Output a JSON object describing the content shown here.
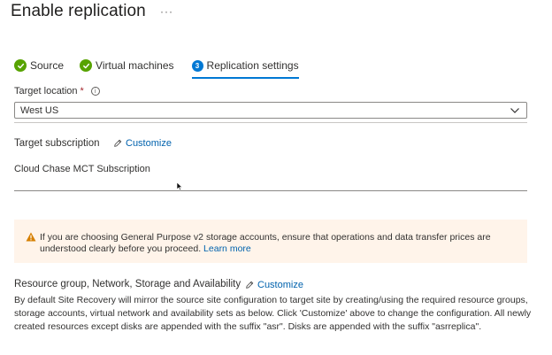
{
  "header": {
    "title": "Enable replication",
    "more_label": "···"
  },
  "steps": [
    {
      "label": "Source",
      "status": "complete"
    },
    {
      "label": "Virtual machines",
      "status": "complete"
    },
    {
      "label": "Replication settings",
      "status": "active",
      "number": "3"
    }
  ],
  "target_location": {
    "label": "Target location",
    "required_mark": "*",
    "info_glyph": "i",
    "value": "West US"
  },
  "target_subscription": {
    "label": "Target subscription",
    "customize_label": "Customize",
    "value": "Cloud Chase MCT Subscription"
  },
  "warning": {
    "text": "If you are choosing General Purpose v2 storage accounts, ensure that operations and data transfer prices are understood clearly before you proceed. ",
    "link": "Learn more"
  },
  "resource_section": {
    "title": "Resource group, Network, Storage and Availability",
    "customize_label": "Customize",
    "description": "By default Site Recovery will mirror the source site configuration to target site by creating/using the required resource groups, storage accounts, virtual network and availability sets as below. Click 'Customize' above to change the configuration. All newly created resources except disks are appended with the suffix \"asr\". Disks are appended with the suffix \"asrreplica\"."
  },
  "colors": {
    "accent": "#0078d4",
    "link": "#0062ad",
    "success": "#57a300",
    "warning_bg": "#fff4ea",
    "warning_icon": "#d67f00",
    "required": "#a4262c"
  },
  "icons": {
    "more": "more-icon",
    "check": "checkmark-icon",
    "info": "info-icon",
    "chevron": "chevron-down-icon",
    "pencil": "pencil-icon",
    "warning": "warning-icon",
    "cursor": "mouse-cursor-icon"
  }
}
